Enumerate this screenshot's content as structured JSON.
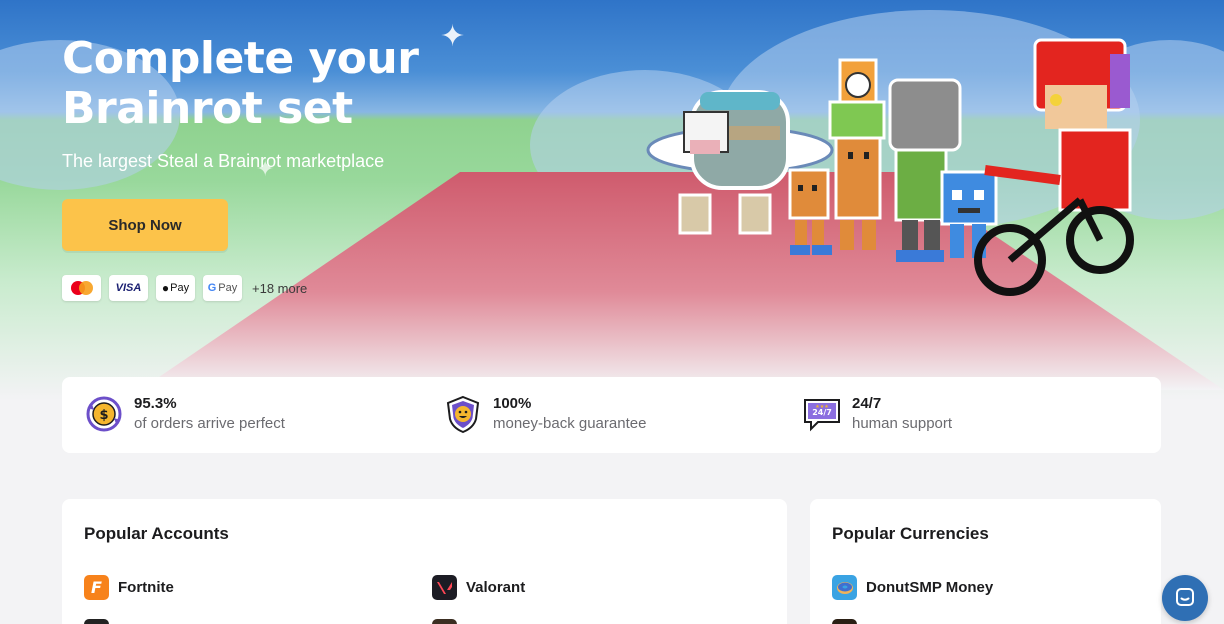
{
  "hero": {
    "title": "Complete your Brainrot set",
    "subtitle": "The largest Steal a Brainrot marketplace",
    "cta_label": "Shop Now",
    "payment_methods": [
      {
        "name": "mastercard-icon"
      },
      {
        "name": "visa-icon",
        "label": "VISA"
      },
      {
        "name": "apple-pay-icon",
        "label": "Pay"
      },
      {
        "name": "google-pay-icon",
        "label": "Pay"
      }
    ],
    "more_payments": "+18 more",
    "colors": {
      "cta": "#fcc34a",
      "sky": "#2f74c8",
      "grass": "#8fd28f",
      "road": "#d9666f"
    }
  },
  "stats": [
    {
      "icon": "coin-cycle-icon",
      "value": "95.3%",
      "label": "of orders arrive perfect"
    },
    {
      "icon": "shield-smile-icon",
      "value": "100%",
      "label": "money-back guarantee"
    },
    {
      "icon": "support-chat-icon",
      "value": "24/7",
      "label": "human support"
    }
  ],
  "popular_accounts": {
    "title": "Popular Accounts",
    "items": [
      {
        "icon": "fortnite-icon",
        "label": "Fortnite",
        "icon_letter": "F",
        "color": "#f7821b"
      },
      {
        "icon": "valorant-icon",
        "label": "Valorant",
        "color": "#1c1c24"
      }
    ]
  },
  "popular_currencies": {
    "title": "Popular Currencies",
    "items": [
      {
        "icon": "donutsmp-icon",
        "label": "DonutSMP Money",
        "color": "#3aa3e3"
      }
    ]
  },
  "support_chat": {
    "icon": "chat-bubble-icon"
  }
}
